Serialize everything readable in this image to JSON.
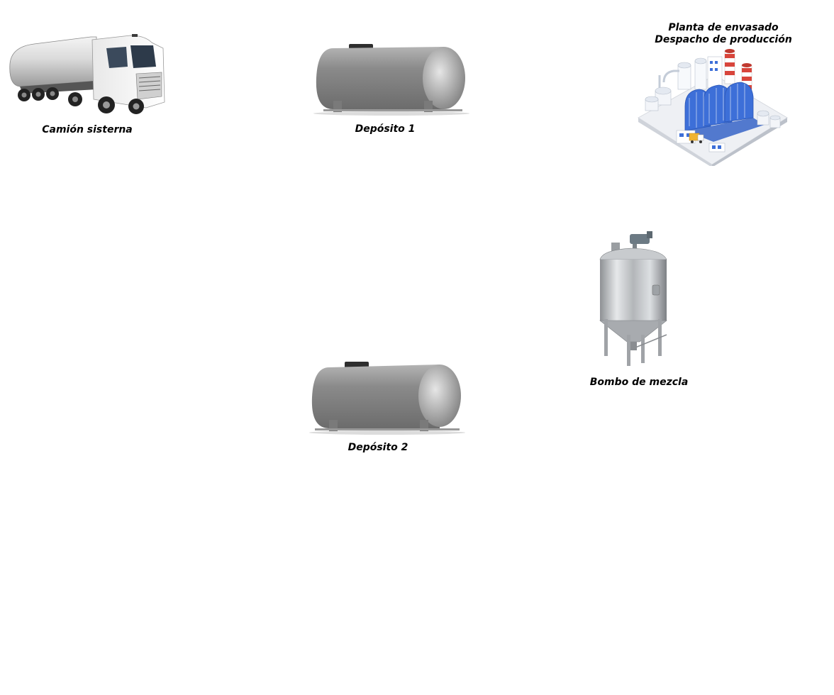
{
  "nodes": {
    "truck": {
      "label": "Camión sisterna"
    },
    "tank1": {
      "label": "Depósito 1"
    },
    "tank2": {
      "label": "Depósito 2"
    },
    "mixer": {
      "label": "Bombo de mezcla"
    },
    "plant": {
      "label_line1": "Planta de envasado",
      "label_line2": "Despacho de producción"
    }
  },
  "colors": {
    "tank_gray": "#8c8c8c",
    "plant_blue": "#3d6fd8",
    "chimney_red": "#d8453b",
    "steel": "#b8babc"
  },
  "icons": [
    "tanker-truck-icon",
    "horizontal-tank-icon",
    "mixing-vessel-icon",
    "factory-icon"
  ]
}
